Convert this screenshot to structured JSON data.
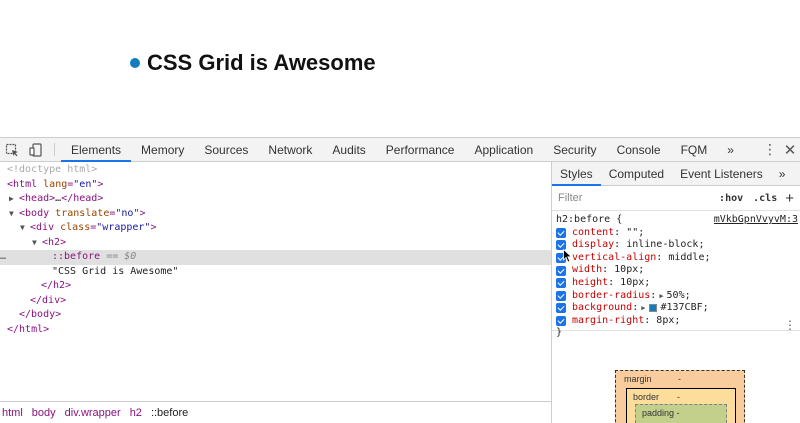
{
  "page": {
    "heading": "CSS Grid is Awesome",
    "bullet_color": "#137CBF"
  },
  "devtools": {
    "tabs": [
      "Elements",
      "Memory",
      "Sources",
      "Network",
      "Audits",
      "Performance",
      "Application",
      "Security",
      "Console",
      "FQM"
    ],
    "active_tab": "Elements",
    "more_tabs": "»",
    "menu_icon": "⋮",
    "close_icon": "✕",
    "tree": {
      "doctype": "<!doctype html>",
      "html_open_tag": "html",
      "html_lang_attr": "lang",
      "html_lang_value": "\"en\"",
      "head_collapsed": "head",
      "head_ellipsis": "…",
      "body_tag": "body",
      "body_attr": "translate",
      "body_value": "\"no\"",
      "div_tag": "div",
      "div_attr": "class",
      "div_value": "\"wrapper\"",
      "h2_tag": "h2",
      "pseudo": "::before",
      "eq_dollar": "== $0",
      "text_node": "\"CSS Grid is Awesome\"",
      "close_h2": "</h2>",
      "close_div": "</div>",
      "close_body": "</body>",
      "close_html": "</html>",
      "row_dots": "…"
    },
    "breadcrumbs": [
      "html",
      "body",
      "div.wrapper",
      "h2",
      "::before"
    ],
    "styles": {
      "tabs": [
        "Styles",
        "Computed",
        "Event Listeners"
      ],
      "active_tab": "Styles",
      "more": "»",
      "filter_placeholder": "Filter",
      "hov": ":hov",
      "cls": ".cls",
      "plus": "+",
      "selector": "h2:before {",
      "source": "mVkbGpnVvyvM:3",
      "closing_brace": "}",
      "declarations": [
        {
          "prop": "content",
          "value": "\"\";"
        },
        {
          "prop": "display",
          "value": "inline-block;"
        },
        {
          "prop": "vertical-align",
          "value": "middle;"
        },
        {
          "prop": "width",
          "value": "10px;"
        },
        {
          "prop": "height",
          "value": "10px;"
        },
        {
          "prop": "border-radius",
          "value": "50%;"
        },
        {
          "prop": "background",
          "value": "#137CBF;"
        },
        {
          "prop": "margin-right",
          "value": "8px;"
        }
      ],
      "swatch_color": "#137CBF"
    },
    "box_model": {
      "margin_label": "margin",
      "margin_value": "-",
      "border_label": "border",
      "border_value": "-",
      "padding_label": "padding -"
    }
  }
}
